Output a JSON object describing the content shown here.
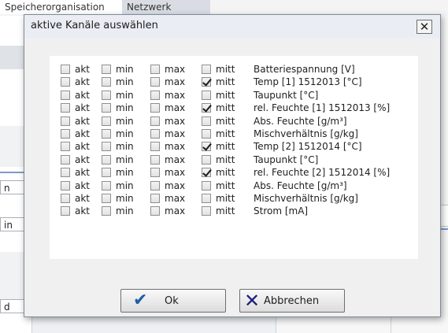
{
  "background": {
    "tabs": [
      "Speicherorganisation",
      "Netzwerk"
    ],
    "field_values": [
      "n",
      "in",
      "d"
    ]
  },
  "dialog": {
    "title": "aktive Kanäle auswählen",
    "close_glyph": "✕",
    "options": [
      "akt",
      "min",
      "max",
      "mitt"
    ],
    "channels": [
      {
        "name": "Batteriespannung [V]",
        "akt": false,
        "min": false,
        "max": false,
        "mitt": false
      },
      {
        "name": "Temp [1] 1512013 [°C]",
        "akt": false,
        "min": false,
        "max": false,
        "mitt": true
      },
      {
        "name": "Taupunkt [°C]",
        "akt": false,
        "min": false,
        "max": false,
        "mitt": false
      },
      {
        "name": "rel. Feuchte [1] 1512013 [%]",
        "akt": false,
        "min": false,
        "max": false,
        "mitt": true
      },
      {
        "name": "Abs. Feuchte [g/m³]",
        "akt": false,
        "min": false,
        "max": false,
        "mitt": false
      },
      {
        "name": "Mischverhältnis [g/kg]",
        "akt": false,
        "min": false,
        "max": false,
        "mitt": false
      },
      {
        "name": "Temp [2] 1512014 [°C]",
        "akt": false,
        "min": false,
        "max": false,
        "mitt": true
      },
      {
        "name": "Taupunkt [°C]",
        "akt": false,
        "min": false,
        "max": false,
        "mitt": false
      },
      {
        "name": "rel. Feuchte [2] 1512014 [%]",
        "akt": false,
        "min": false,
        "max": false,
        "mitt": true
      },
      {
        "name": "Abs. Feuchte [g/m³]",
        "akt": false,
        "min": false,
        "max": false,
        "mitt": false
      },
      {
        "name": "Mischverhältnis [g/kg]",
        "akt": false,
        "min": false,
        "max": false,
        "mitt": false
      },
      {
        "name": "Strom [mA]",
        "akt": false,
        "min": false,
        "max": false,
        "mitt": false
      }
    ],
    "ok_label": "Ok",
    "ok_icon": "checkmark-icon",
    "cancel_label": "Abbrechen",
    "cancel_icon": "x-icon"
  }
}
